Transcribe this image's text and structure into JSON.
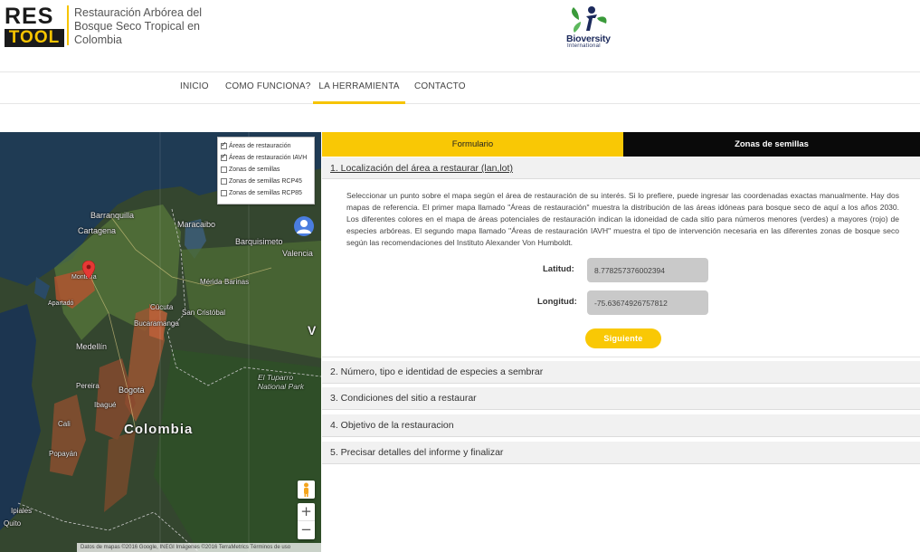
{
  "header": {
    "logo_top": "RES",
    "logo_bottom": "TOOL",
    "tagline": "Restauración Arbórea del Bosque Seco Tropical en Colombia",
    "partner_name": "Bioversity",
    "partner_sub": "International"
  },
  "nav": {
    "items": [
      {
        "label": "INICIO"
      },
      {
        "label": "COMO FUNCIONA?"
      },
      {
        "label": "LA HERRAMIENTA"
      },
      {
        "label": "CONTACTO"
      }
    ],
    "active": "LA HERRAMIENTA"
  },
  "map": {
    "layers": [
      {
        "label": "Áreas de restauración",
        "checked": true
      },
      {
        "label": "Áreas de restauración IAVH",
        "checked": true
      },
      {
        "label": "Zonas de semillas",
        "checked": false
      },
      {
        "label": "Zonas de semillas RCP45",
        "checked": false
      },
      {
        "label": "Zonas de semillas RCP85",
        "checked": false
      }
    ],
    "places": {
      "barranquilla": "Barranquilla",
      "cartagena": "Cartagena",
      "maracaibo": "Maracaibo",
      "barquisimeto": "Barquisimeto",
      "valencia": "Valencia",
      "monteria": "Montería",
      "apartado": "Apartadó",
      "cucuta": "Cúcuta",
      "san_cristobal": "San Cristóbal",
      "merida": "Mérida",
      "barinas": "Barinas",
      "bucaramanga": "Bucaramanga",
      "medellin": "Medellín",
      "pereira": "Pereira",
      "bogota": "Bogotá",
      "ibague": "Ibagué",
      "cali": "Cali",
      "colombia": "Colombia",
      "popayan": "Popayán",
      "tuparro": "El Tuparro National Park",
      "ipiales": "Ipiales",
      "quito": "Quito",
      "venezuela_letter": "V"
    },
    "attribution": "Datos de mapas ©2016 Google, INEGI Imágenes ©2016 TerraMetrics   Términos de uso",
    "zoom_in": "+",
    "zoom_out": "−",
    "pin_color": "#e53935"
  },
  "tabs": {
    "form": "Formulario",
    "seeds": "Zonas de semillas"
  },
  "section1": {
    "title": "1. Localización del área a restaurar (lan,lot)",
    "intro": "Seleccionar un punto sobre el mapa según el área de restauración de su interés. Si lo prefiere, puede ingresar las coordenadas exactas manualmente. Hay dos mapas de referencia. El primer mapa llamado \"Áreas de restauración\" muestra la distribución de las áreas idóneas para bosque seco de aquí a los años 2030. Los diferentes colores en el mapa de áreas potenciales de restauración indican la idoneidad de cada sitio para números menores (verdes) a mayores (rojo) de especies arbóreas. El segundo mapa llamado \"Áreas de restauración IAVH\" muestra el tipo de intervención necesaria en las diferentes zonas de bosque seco según las recomendaciones del Instituto Alexander Von Humboldt.",
    "lat_label": "Latitud:",
    "lat_value": "8.778257376002394",
    "lon_label": "Longitud:",
    "lon_value": "-75.63674926757812",
    "next_button": "Siguiente"
  },
  "sections": [
    {
      "title": "2. Número, tipo e identidad de especies a sembrar"
    },
    {
      "title": "3. Condiciones del sitio a restaurar"
    },
    {
      "title": "4. Objetivo de la restauracion"
    },
    {
      "title": "5. Precisar detalles del informe y finalizar"
    }
  ],
  "colors": {
    "accent": "#f9c805",
    "dark": "#0a0a0a"
  }
}
